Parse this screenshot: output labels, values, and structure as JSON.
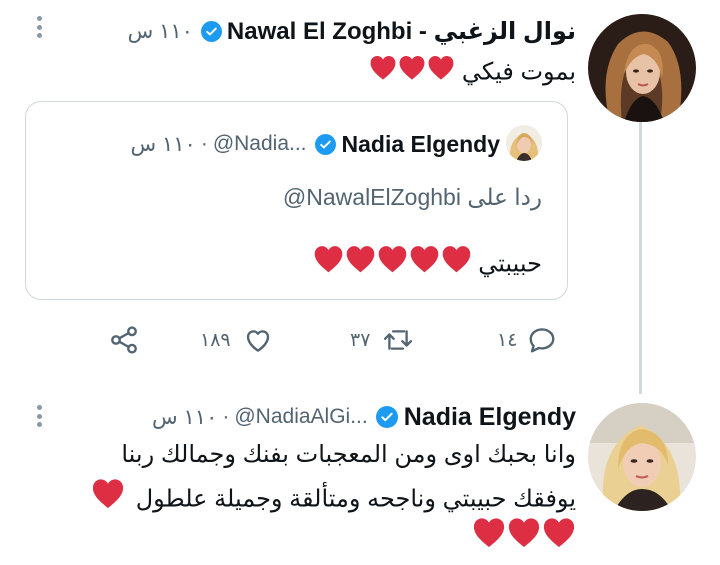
{
  "tweet": {
    "author_name": "نوال الزغبي - Nawal El Zoghbi",
    "time": "١١٠ س",
    "text": "بموت فيكي",
    "hearts": 3,
    "quoted": {
      "author_name": "Nadia Elgendy",
      "handle": "@Nadia...",
      "time": "١١٠ س",
      "reply_prefix": "ردا على",
      "reply_handle": "@NawalElZoghbi",
      "text": "حبيبتي",
      "hearts": 5
    },
    "actions": {
      "replies": "١٤",
      "retweets": "٣٧",
      "likes": "١٨٩"
    }
  },
  "reply": {
    "author_name": "Nadia Elgendy",
    "handle": "@NadiaAlGi...",
    "time": "١١٠ س",
    "line1": "وانا بحبك اوى ومن المعجبات بفنك وجمالك ربنا",
    "line2": "يوفقك حبيبتي وناجحه ومتألقة وجميلة علطول",
    "hearts_line2": 1,
    "hearts_line3": 3
  },
  "colors": {
    "verified": "#1d9bf0",
    "heart": "#dd2e44",
    "muted": "#536471",
    "border": "#cfd9de"
  },
  "icons": [
    "verified-badge-icon",
    "heart-emoji-icon",
    "reply-icon",
    "retweet-icon",
    "like-icon",
    "share-icon",
    "more-icon"
  ]
}
